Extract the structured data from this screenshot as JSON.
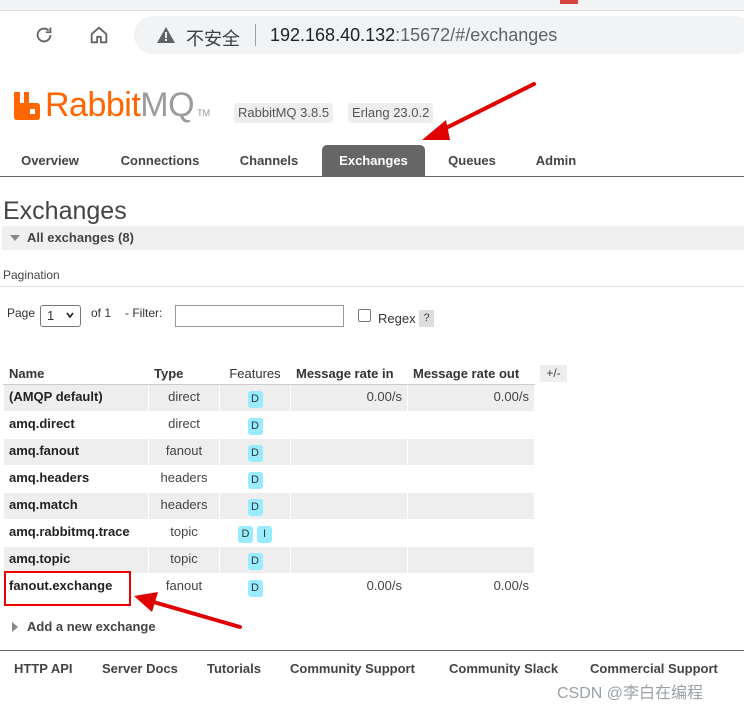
{
  "browser": {
    "insecure_label": "不安全",
    "url_host": "192.168.40.132",
    "url_rest": ":15672/#/exchanges"
  },
  "header": {
    "logo_rabbit": "Rabbit",
    "logo_mq": "MQ",
    "logo_tm": "TM",
    "version_rabbitmq": "RabbitMQ 3.8.5",
    "version_erlang": "Erlang 23.0.2",
    "brand_color": "#ff6600"
  },
  "tabs": [
    {
      "label": "Overview"
    },
    {
      "label": "Connections"
    },
    {
      "label": "Channels"
    },
    {
      "label": "Exchanges",
      "active": true
    },
    {
      "label": "Queues"
    },
    {
      "label": "Admin"
    }
  ],
  "page": {
    "title": "Exchanges",
    "section_label": "All exchanges (8)",
    "pagination_label": "Pagination",
    "page_label": "Page",
    "page_value": "1",
    "of_label": "of 1",
    "filter_label": "- Filter:",
    "filter_value": "",
    "regex_label": "Regex",
    "help_label": "?",
    "column_toggle": "+/-"
  },
  "table": {
    "headers": {
      "name": "Name",
      "type": "Type",
      "features": "Features",
      "rate_in": "Message rate in",
      "rate_out": "Message rate out"
    },
    "rows": [
      {
        "name": "(AMQP default)",
        "type": "direct",
        "features": "D",
        "rate_in": "0.00/s",
        "rate_out": "0.00/s"
      },
      {
        "name": "amq.direct",
        "type": "direct",
        "features": "D",
        "rate_in": "",
        "rate_out": ""
      },
      {
        "name": "amq.fanout",
        "type": "fanout",
        "features": "D",
        "rate_in": "",
        "rate_out": ""
      },
      {
        "name": "amq.headers",
        "type": "headers",
        "features": "D",
        "rate_in": "",
        "rate_out": ""
      },
      {
        "name": "amq.match",
        "type": "headers",
        "features": "D",
        "rate_in": "",
        "rate_out": ""
      },
      {
        "name": "amq.rabbitmq.trace",
        "type": "topic",
        "features": "D",
        "features2": "I",
        "rate_in": "",
        "rate_out": ""
      },
      {
        "name": "amq.topic",
        "type": "topic",
        "features": "D",
        "rate_in": "",
        "rate_out": ""
      },
      {
        "name": "fanout.exchange",
        "type": "fanout",
        "features": "D",
        "rate_in": "0.00/s",
        "rate_out": "0.00/s"
      }
    ]
  },
  "add_exchange_label": "Add a new exchange",
  "footer": {
    "links": [
      "HTTP API",
      "Server Docs",
      "Tutorials",
      "Community Support",
      "Community Slack",
      "Commercial Support"
    ]
  },
  "watermark": "CSDN @李白在编程",
  "annotation_color": "#e00000"
}
